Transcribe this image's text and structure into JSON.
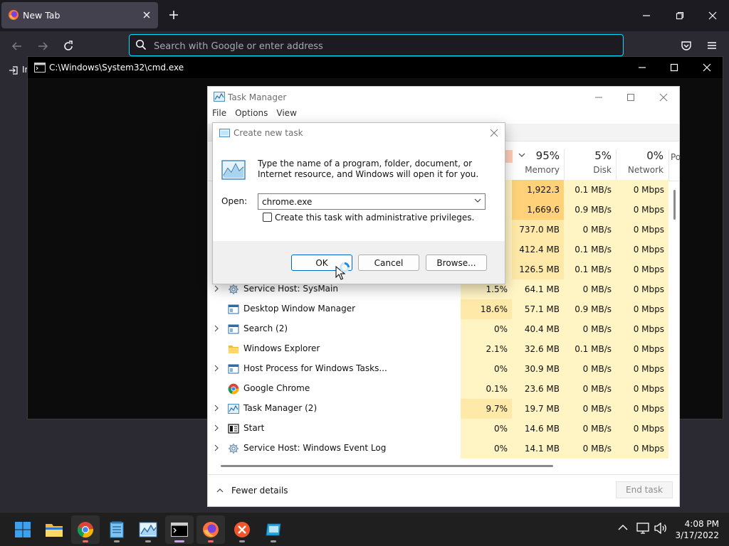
{
  "firefox": {
    "tab_title": "New Tab",
    "url_placeholder": "Search with Google or enter address",
    "bookmark_stub": "Ir"
  },
  "cmd": {
    "title": "C:\\Windows\\System32\\cmd.exe"
  },
  "task_manager": {
    "title": "Task Manager",
    "menu": [
      "File",
      "Options",
      "View"
    ],
    "columns": [
      {
        "pct": "95%",
        "label": "Memory"
      },
      {
        "pct": "5%",
        "label": "Disk"
      },
      {
        "pct": "0%",
        "label": "Network"
      },
      {
        "pct": "",
        "label": "Po"
      }
    ],
    "rows": [
      {
        "name": "",
        "cpu": "",
        "mem": "1,922.3 MB",
        "disk": "0.1 MB/s",
        "net": "0 Mbps"
      },
      {
        "name": "",
        "cpu": "",
        "mem": "1,669.6 MB",
        "disk": "0.9 MB/s",
        "net": "0 Mbps"
      },
      {
        "name": "",
        "cpu": "",
        "mem": "737.0 MB",
        "disk": "0 MB/s",
        "net": "0 Mbps"
      },
      {
        "name": "",
        "cpu": "",
        "mem": "412.4 MB",
        "disk": "0.1 MB/s",
        "net": "0 Mbps"
      },
      {
        "name": "",
        "cpu": "",
        "mem": "126.5 MB",
        "disk": "0.1 MB/s",
        "net": "0 Mbps"
      },
      {
        "name": "Service Host: SysMain",
        "cpu": "1.5%",
        "mem": "64.1 MB",
        "disk": "0 MB/s",
        "net": "0 Mbps",
        "expand": true,
        "icon": "gear"
      },
      {
        "name": "Desktop Window Manager",
        "cpu": "18.6%",
        "mem": "57.1 MB",
        "disk": "0.9 MB/s",
        "net": "0 Mbps",
        "expand": false,
        "icon": "window"
      },
      {
        "name": "Search (2)",
        "cpu": "0%",
        "mem": "40.4 MB",
        "disk": "0 MB/s",
        "net": "0 Mbps",
        "expand": true,
        "icon": "window"
      },
      {
        "name": "Windows Explorer",
        "cpu": "2.1%",
        "mem": "32.6 MB",
        "disk": "0.1 MB/s",
        "net": "0 Mbps",
        "expand": false,
        "icon": "folder"
      },
      {
        "name": "Host Process for Windows Tasks...",
        "cpu": "0%",
        "mem": "30.9 MB",
        "disk": "0 MB/s",
        "net": "0 Mbps",
        "expand": true,
        "icon": "window"
      },
      {
        "name": "Google Chrome",
        "cpu": "0.1%",
        "mem": "23.6 MB",
        "disk": "0 MB/s",
        "net": "0 Mbps",
        "expand": false,
        "icon": "chrome"
      },
      {
        "name": "Task Manager (2)",
        "cpu": "9.7%",
        "mem": "19.7 MB",
        "disk": "0 MB/s",
        "net": "0 Mbps",
        "expand": true,
        "icon": "taskmgr"
      },
      {
        "name": "Start",
        "cpu": "0%",
        "mem": "14.6 MB",
        "disk": "0 MB/s",
        "net": "0 Mbps",
        "expand": true,
        "icon": "start"
      },
      {
        "name": "Service Host: Windows Event Log",
        "cpu": "0%",
        "mem": "14.1 MB",
        "disk": "0 MB/s",
        "net": "0 Mbps",
        "expand": true,
        "icon": "gear"
      }
    ],
    "fewer_details": "Fewer details",
    "end_task": "End task"
  },
  "dialog": {
    "title": "Create new task",
    "description": "Type the name of a program, folder, document, or Internet resource, and Windows will open it for you.",
    "open_label": "Open:",
    "open_value": "chrome.exe",
    "admin_checkbox_label": "Create this task with administrative privileges.",
    "admin_checked": false,
    "ok": "OK",
    "cancel": "Cancel",
    "browse": "Browse..."
  },
  "taskbar": {
    "apps": [
      "start-icon",
      "file-explorer-icon",
      "chrome-icon",
      "notepad-icon",
      "task-manager-icon",
      "terminal-icon",
      "firefox-icon",
      "xampp-icon",
      "virtualbox-icon"
    ],
    "time": "4:08 PM",
    "date": "3/17/2022"
  },
  "colors": {
    "accent_url_focus": "#00ddff",
    "heat_light": "#fff4c4",
    "heat_mid": "#ffe9a8",
    "heat_high": "#ffd27a"
  }
}
